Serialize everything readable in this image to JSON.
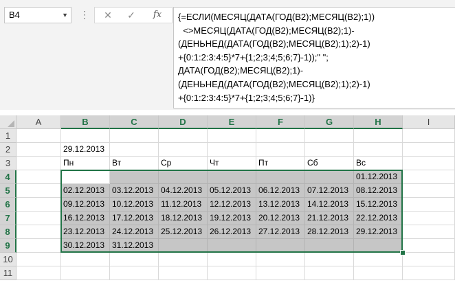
{
  "namebox": {
    "value": "B4"
  },
  "formula_lines": [
    "{=ЕСЛИ(МЕСЯЦ(ДАТА(ГОД(B2);МЕСЯЦ(B2);1))",
    "  <>МЕСЯЦ(ДАТА(ГОД(B2);МЕСЯЦ(B2);1)-",
    "(ДЕНЬНЕД(ДАТА(ГОД(B2);МЕСЯЦ(B2);1);2)-1)",
    "+{0:1:2:3:4:5}*7+{1;2;3;4;5;6;7}-1));\" \";",
    "ДАТА(ГОД(B2);МЕСЯЦ(B2);1)-",
    "(ДЕНЬНЕД(ДАТА(ГОД(B2);МЕСЯЦ(B2);1);2)-1)",
    "+{0:1:2:3:4:5}*7+{1;2;3;4;5;6;7}-1)}"
  ],
  "columns": [
    "A",
    "B",
    "C",
    "D",
    "E",
    "F",
    "G",
    "H",
    "I"
  ],
  "rows": [
    "1",
    "2",
    "3",
    "4",
    "5",
    "6",
    "7",
    "8",
    "9",
    "10",
    "11"
  ],
  "b2_value": "29.12.2013",
  "weekdays": [
    "Пн",
    "Вт",
    "Ср",
    "Чт",
    "Пт",
    "Сб",
    "Вс"
  ],
  "calendar": [
    [
      "",
      "",
      "",
      "",
      "",
      "",
      "01.12.2013"
    ],
    [
      "02.12.2013",
      "03.12.2013",
      "04.12.2013",
      "05.12.2013",
      "06.12.2013",
      "07.12.2013",
      "08.12.2013"
    ],
    [
      "09.12.2013",
      "10.12.2013",
      "11.12.2013",
      "12.12.2013",
      "13.12.2013",
      "14.12.2013",
      "15.12.2013"
    ],
    [
      "16.12.2013",
      "17.12.2013",
      "18.12.2013",
      "19.12.2013",
      "20.12.2013",
      "21.12.2013",
      "22.12.2013"
    ],
    [
      "23.12.2013",
      "24.12.2013",
      "25.12.2013",
      "26.12.2013",
      "27.12.2013",
      "28.12.2013",
      "29.12.2013"
    ],
    [
      "30.12.2013",
      "31.12.2013",
      "",
      "",
      "",
      "",
      ""
    ]
  ]
}
